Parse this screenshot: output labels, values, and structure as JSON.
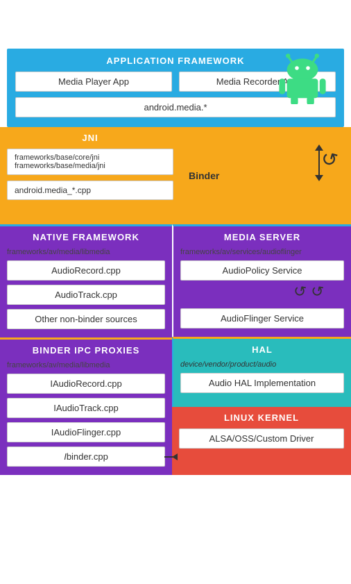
{
  "androidLogo": {
    "color": "#3DDC84",
    "bodyColor": "#3DDC84"
  },
  "appFramework": {
    "title": "APPLICATION FRAMEWORK",
    "mediaPlayer": "Media Player App",
    "mediaRecorder": "Media Recorder App",
    "androidMedia": "android.media.*"
  },
  "jni": {
    "title": "JNI",
    "path1": "frameworks/base/core/jni\nframeworks/base/media/jni",
    "path2": "android.media_*.cpp"
  },
  "binder": {
    "label": "Binder"
  },
  "nativeFramework": {
    "title": "NATIVE FRAMEWORK",
    "path": "frameworks/av/media/libmedia",
    "items": [
      "AudioRecord.cpp",
      "AudioTrack.cpp",
      "Other non-binder sources"
    ]
  },
  "mediaServer": {
    "title": "MEDIA SERVER",
    "path": "frameworks/av/services/audioflinger",
    "items": [
      "AudioPolicy Service",
      "AudioFlinger Service"
    ]
  },
  "binderIpc": {
    "title": "BINDER IPC PROXIES",
    "path": "frameworks/av/media/libmedia",
    "items": [
      "IAudioRecord.cpp",
      "IAudioTrack.cpp",
      "IAudioFlinger.cpp",
      "Ibinder.cpp"
    ]
  },
  "hal": {
    "title": "HAL",
    "path": "device/vendor/product/audio",
    "items": [
      "Audio HAL Implementation"
    ]
  },
  "kernel": {
    "title": "LINUX KERNEL",
    "items": [
      "ALSA/OSS/Custom Driver"
    ]
  }
}
